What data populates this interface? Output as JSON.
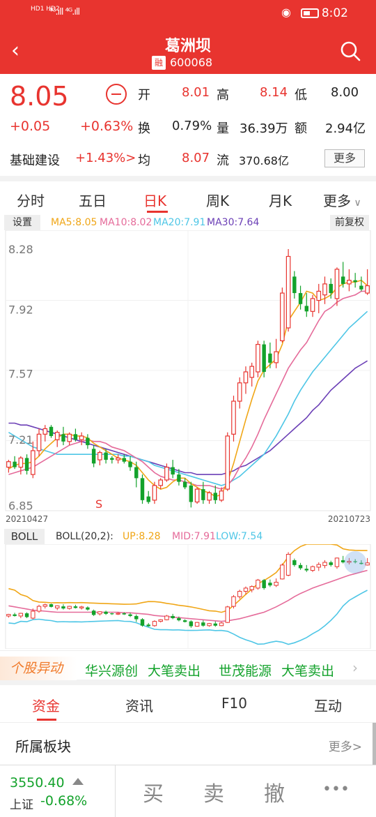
{
  "status_bar": {
    "left_labels": "HD1 HD2",
    "signal": "⁴ᴳ.ıll ⁴ᴳ.ıll ",
    "time": "8:02"
  },
  "header": {
    "title": "葛洲坝",
    "badge": "融",
    "code": "600068"
  },
  "quote": {
    "price": "8.05",
    "change": "+0.05",
    "change_pct": "+0.63%",
    "sector": "基础建设",
    "sector_change": "+1.43%>",
    "fields": [
      {
        "label": "开",
        "value": "8.01",
        "color": "red"
      },
      {
        "label": "高",
        "value": "8.14",
        "color": "red"
      },
      {
        "label": "低",
        "value": "8.00",
        "color": "dark"
      },
      {
        "label": "换",
        "value": "0.79%",
        "color": "dark"
      },
      {
        "label": "量",
        "value": "36.39万",
        "color": "dark"
      },
      {
        "label": "额",
        "value": "2.94亿",
        "color": "dark"
      },
      {
        "label": "均",
        "value": "8.07",
        "color": "red"
      },
      {
        "label": "流",
        "value": "370.68亿",
        "color": "dark"
      }
    ],
    "more_label": "更多"
  },
  "tabs": [
    "分时",
    "五日",
    "日K",
    "周K",
    "月K",
    "更多"
  ],
  "active_tab": 2,
  "ma": {
    "settings": "设置",
    "ma5": "MA5:8.05",
    "ma10": "MA10:8.02",
    "ma20": "MA20:7.91",
    "ma30": "MA30:7.64",
    "adjust": "前复权"
  },
  "boll": {
    "button": "BOLL",
    "label": "BOLL(20,2):",
    "up": "UP:8.28",
    "mid": "MID:7.91",
    "low": "LOW:7.54"
  },
  "colors": {
    "up": "#e8342f",
    "down": "#13a22b",
    "ma5": "#f0a616",
    "ma10": "#e56b9a",
    "ma20": "#4ec6e6",
    "ma30": "#6b3fb6"
  },
  "chart_data": {
    "type": "candlestick",
    "y_ticks": [
      "8.28",
      "7.92",
      "7.57",
      "7.21",
      "6.85"
    ],
    "ylim": [
      6.83,
      8.33
    ],
    "date_start": "20210427",
    "date_end": "20210723",
    "marker": "S",
    "candles": [
      [
        7.06,
        7.1,
        7.03,
        7.09
      ],
      [
        7.09,
        7.12,
        7.05,
        7.06
      ],
      [
        7.06,
        7.12,
        7.02,
        7.11
      ],
      [
        7.11,
        7.13,
        7.02,
        7.04
      ],
      [
        7.02,
        7.2,
        7.0,
        7.15
      ],
      [
        7.15,
        7.27,
        7.12,
        7.24
      ],
      [
        7.24,
        7.29,
        7.2,
        7.27
      ],
      [
        7.28,
        7.29,
        7.22,
        7.23
      ],
      [
        7.21,
        7.26,
        7.17,
        7.25
      ],
      [
        7.24,
        7.28,
        7.18,
        7.2
      ],
      [
        7.2,
        7.25,
        7.18,
        7.24
      ],
      [
        7.24,
        7.27,
        7.2,
        7.21
      ],
      [
        7.21,
        7.25,
        7.18,
        7.23
      ],
      [
        7.22,
        7.24,
        7.16,
        7.18
      ],
      [
        7.16,
        7.18,
        7.06,
        7.08
      ],
      [
        7.1,
        7.15,
        7.07,
        7.14
      ],
      [
        7.14,
        7.16,
        7.08,
        7.1
      ],
      [
        7.11,
        7.12,
        7.08,
        7.1
      ],
      [
        7.1,
        7.13,
        7.08,
        7.11
      ],
      [
        7.11,
        7.13,
        7.08,
        7.09
      ],
      [
        7.09,
        7.12,
        7.04,
        7.06
      ],
      [
        7.06,
        7.09,
        6.95,
        7.0
      ],
      [
        7.0,
        7.02,
        6.86,
        6.88
      ],
      [
        6.9,
        6.93,
        6.86,
        6.87
      ],
      [
        6.88,
        6.98,
        6.86,
        6.96
      ],
      [
        6.96,
        7.0,
        6.94,
        6.99
      ],
      [
        6.99,
        7.08,
        6.98,
        7.06
      ],
      [
        7.06,
        7.1,
        7.0,
        7.02
      ],
      [
        7.02,
        7.05,
        6.96,
        6.98
      ],
      [
        6.98,
        7.0,
        6.94,
        6.95
      ],
      [
        6.96,
        6.98,
        6.84,
        6.87
      ],
      [
        6.87,
        6.95,
        6.86,
        6.94
      ],
      [
        6.94,
        6.98,
        6.86,
        6.88
      ],
      [
        6.88,
        6.93,
        6.86,
        6.92
      ],
      [
        6.92,
        6.96,
        6.86,
        6.88
      ],
      [
        6.88,
        6.95,
        6.87,
        6.93
      ],
      [
        6.94,
        7.25,
        6.93,
        7.23
      ],
      [
        7.24,
        7.45,
        7.2,
        7.42
      ],
      [
        7.42,
        7.55,
        7.38,
        7.52
      ],
      [
        7.52,
        7.61,
        7.46,
        7.58
      ],
      [
        7.55,
        7.63,
        7.5,
        7.61
      ],
      [
        7.58,
        7.75,
        7.55,
        7.73
      ],
      [
        7.73,
        7.75,
        7.55,
        7.58
      ],
      [
        7.68,
        7.74,
        7.6,
        7.63
      ],
      [
        7.63,
        7.76,
        7.6,
        7.69
      ],
      [
        7.75,
        8.04,
        7.74,
        8.01
      ],
      [
        7.82,
        8.25,
        7.8,
        8.21
      ],
      [
        8.1,
        8.13,
        7.98,
        8.01
      ],
      [
        8.01,
        8.05,
        7.92,
        7.95
      ],
      [
        7.94,
        8.01,
        7.88,
        7.91
      ],
      [
        7.91,
        8.0,
        7.88,
        7.98
      ],
      [
        7.97,
        8.06,
        7.9,
        8.02
      ],
      [
        8.0,
        8.1,
        7.95,
        8.06
      ],
      [
        8.06,
        8.09,
        7.98,
        8.01
      ],
      [
        7.98,
        8.15,
        7.94,
        8.14
      ],
      [
        8.1,
        8.18,
        8.04,
        8.06
      ],
      [
        8.06,
        8.14,
        8.02,
        8.08
      ],
      [
        8.08,
        8.12,
        8.04,
        8.07
      ],
      [
        8.05,
        8.1,
        8.02,
        8.03
      ],
      [
        8.01,
        8.14,
        8.0,
        8.05
      ]
    ],
    "ma5": [
      7.05,
      7.07,
      7.08,
      7.08,
      7.09,
      7.12,
      7.16,
      7.19,
      7.22,
      7.24,
      7.24,
      7.23,
      7.23,
      7.22,
      7.19,
      7.17,
      7.15,
      7.13,
      7.11,
      7.1,
      7.09,
      7.07,
      7.03,
      6.99,
      6.96,
      6.94,
      6.95,
      6.98,
      7.0,
      7.0,
      6.97,
      6.95,
      6.93,
      6.92,
      6.9,
      6.91,
      6.98,
      7.08,
      7.2,
      7.32,
      7.43,
      7.53,
      7.59,
      7.62,
      7.65,
      7.73,
      7.86,
      7.91,
      7.96,
      8.02,
      8.01,
      7.97,
      7.98,
      8.0,
      8.04,
      8.06,
      8.07,
      8.07,
      8.08,
      8.05
    ],
    "ma10": [
      7.02,
      7.03,
      7.04,
      7.05,
      7.06,
      7.08,
      7.1,
      7.12,
      7.14,
      7.16,
      7.18,
      7.19,
      7.2,
      7.21,
      7.2,
      7.2,
      7.19,
      7.17,
      7.16,
      7.15,
      7.13,
      7.11,
      7.09,
      7.06,
      7.03,
      7.01,
      7.0,
      6.99,
      6.99,
      6.98,
      6.97,
      6.96,
      6.96,
      6.96,
      6.95,
      6.94,
      6.96,
      7.0,
      7.06,
      7.11,
      7.17,
      7.24,
      7.32,
      7.39,
      7.46,
      7.53,
      7.6,
      7.65,
      7.7,
      7.74,
      7.8,
      7.86,
      7.91,
      7.93,
      7.96,
      7.98,
      7.99,
      8.0,
      8.02,
      8.02
    ],
    "ma20": [
      7.25,
      7.23,
      7.21,
      7.19,
      7.17,
      7.16,
      7.15,
      7.14,
      7.13,
      7.13,
      7.13,
      7.13,
      7.13,
      7.13,
      7.13,
      7.13,
      7.13,
      7.13,
      7.13,
      7.12,
      7.12,
      7.11,
      7.1,
      7.09,
      7.07,
      7.06,
      7.05,
      7.04,
      7.03,
      7.02,
      7.01,
      7.0,
      6.99,
      6.98,
      6.97,
      6.96,
      6.97,
      6.99,
      7.01,
      7.04,
      7.07,
      7.1,
      7.13,
      7.18,
      7.23,
      7.29,
      7.35,
      7.42,
      7.48,
      7.53,
      7.58,
      7.62,
      7.66,
      7.7,
      7.74,
      7.78,
      7.82,
      7.85,
      7.88,
      7.91
    ],
    "ma30": [
      7.3,
      7.3,
      7.29,
      7.29,
      7.28,
      7.27,
      7.26,
      7.25,
      7.24,
      7.23,
      7.22,
      7.21,
      7.2,
      7.19,
      7.18,
      7.17,
      7.16,
      7.15,
      7.14,
      7.13,
      7.12,
      7.11,
      7.1,
      7.09,
      7.08,
      7.07,
      7.06,
      7.05,
      7.04,
      7.03,
      7.03,
      7.02,
      7.02,
      7.02,
      7.02,
      7.02,
      7.03,
      7.04,
      7.06,
      7.07,
      7.09,
      7.11,
      7.13,
      7.15,
      7.18,
      7.21,
      7.24,
      7.27,
      7.3,
      7.33,
      7.37,
      7.4,
      7.44,
      7.48,
      7.51,
      7.54,
      7.57,
      7.6,
      7.62,
      7.64
    ]
  },
  "ticker": {
    "badge": "个股异动",
    "items": [
      "华兴源创",
      "大笔卖出",
      "世茂能源",
      "大笔卖出"
    ]
  },
  "bottom_tabs": [
    "资金",
    "资讯",
    "F10",
    "互动"
  ],
  "sector_block": {
    "title": "所属板块",
    "more": "更多>"
  },
  "bottom_bar": {
    "index_value": "3550.40",
    "index_name": "上证",
    "index_change": "-0.68%",
    "actions": [
      "买",
      "卖",
      "撤",
      "•••"
    ]
  }
}
